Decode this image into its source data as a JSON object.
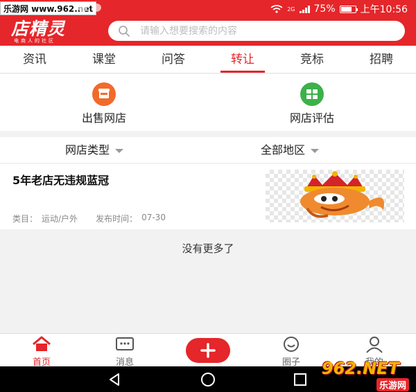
{
  "status_bar": {
    "site_label": "乐游网 www.962.net",
    "network": "2G",
    "battery_percent": "75%",
    "battery_level": 0.75,
    "time": "上午10:56"
  },
  "header": {
    "logo_text": "店精灵",
    "logo_sub": "电商人的社区",
    "search_placeholder": "请输入想要搜索的内容"
  },
  "tabs": [
    {
      "label": "资讯",
      "active": false
    },
    {
      "label": "课堂",
      "active": false
    },
    {
      "label": "问答",
      "active": false
    },
    {
      "label": "转让",
      "active": true
    },
    {
      "label": "竞标",
      "active": false
    },
    {
      "label": "招聘",
      "active": false
    }
  ],
  "actions": [
    {
      "label": "出售网店",
      "icon": "shop-icon",
      "color": "#f26a2a"
    },
    {
      "label": "网店评估",
      "icon": "grid-icon",
      "color": "#3cb14a"
    }
  ],
  "filters": {
    "type_label": "网店类型",
    "region_label": "全部地区"
  },
  "listing": {
    "title": "5年老店无违规蓝冠",
    "category_label": "类目：",
    "category_value": "运动/户外",
    "date_label": "发布时间：",
    "date_value": "07-30"
  },
  "no_more_text": "没有更多了",
  "bottom_nav": {
    "home": "首页",
    "messages": "消息",
    "circle": "圈子",
    "mine": "我的"
  },
  "watermark": {
    "big": "962.NET",
    "small": "乐游网"
  },
  "colors": {
    "brand_red": "#e5262a",
    "orange": "#f26a2a",
    "green": "#3cb14a"
  }
}
